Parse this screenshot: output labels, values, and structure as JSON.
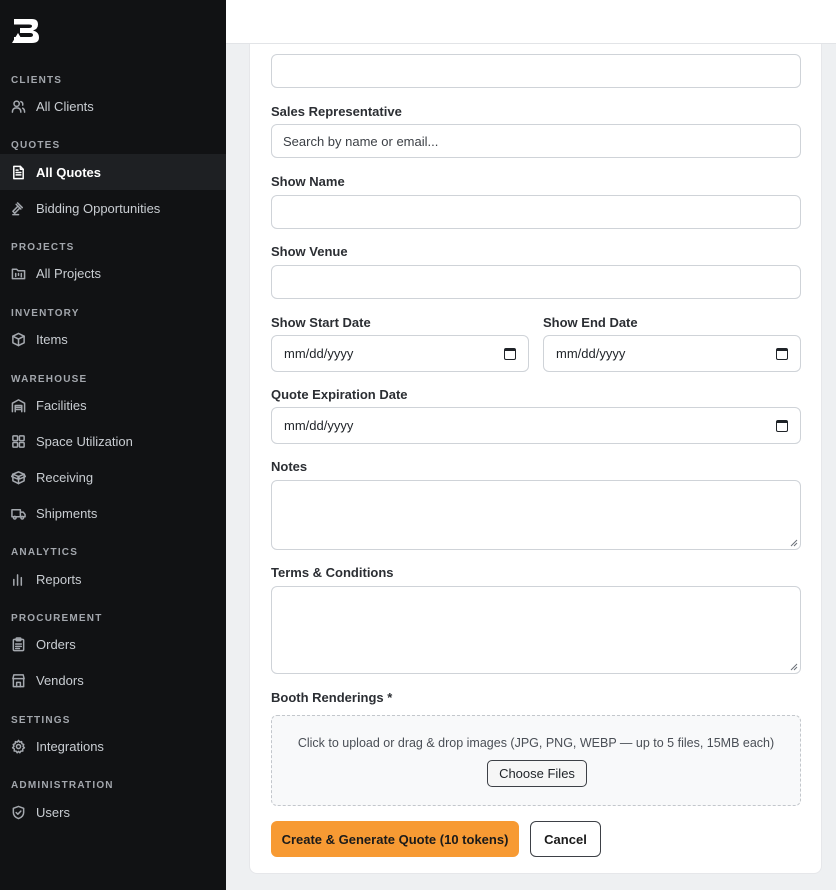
{
  "sidebar": {
    "sections": {
      "clients": "CLIENTS",
      "quotes": "QUOTES",
      "projects": "PROJECTS",
      "inventory": "INVENTORY",
      "warehouse": "WAREHOUSE",
      "analytics": "ANALYTICS",
      "procurement": "PROCUREMENT",
      "settings": "SETTINGS",
      "administration": "ADMINISTRATION"
    },
    "items": {
      "all_clients": "All Clients",
      "all_quotes": "All Quotes",
      "bidding": "Bidding Opportunities",
      "all_projects": "All Projects",
      "items": "Items",
      "facilities": "Facilities",
      "space": "Space Utilization",
      "receiving": "Receiving",
      "shipments": "Shipments",
      "reports": "Reports",
      "orders": "Orders",
      "vendors": "Vendors",
      "integrations": "Integrations",
      "users": "Users"
    },
    "active_item": "All Quotes"
  },
  "form": {
    "sales_rep": {
      "label": "Sales Representative",
      "placeholder": "Search by name or email..."
    },
    "show_name": {
      "label": "Show Name",
      "value": ""
    },
    "show_venue": {
      "label": "Show Venue",
      "value": ""
    },
    "show_start": {
      "label": "Show Start Date",
      "value": "mm/dd/yyyy"
    },
    "show_end": {
      "label": "Show End Date",
      "value": "mm/dd/yyyy"
    },
    "quote_exp": {
      "label": "Quote Expiration Date",
      "value": "mm/dd/yyyy"
    },
    "notes": {
      "label": "Notes",
      "value": ""
    },
    "terms": {
      "label": "Terms & Conditions",
      "value": ""
    },
    "booth": {
      "label": "Booth Renderings *",
      "hint": "Click to upload or drag & drop images (JPG, PNG, WEBP — up to 5 files, 15MB each)",
      "choose_label": "Choose Files"
    },
    "submit_label": "Create & Generate Quote (10 tokens)",
    "cancel_label": "Cancel"
  },
  "colors": {
    "sidebar_bg": "#111214",
    "primary": "#f79a33"
  }
}
